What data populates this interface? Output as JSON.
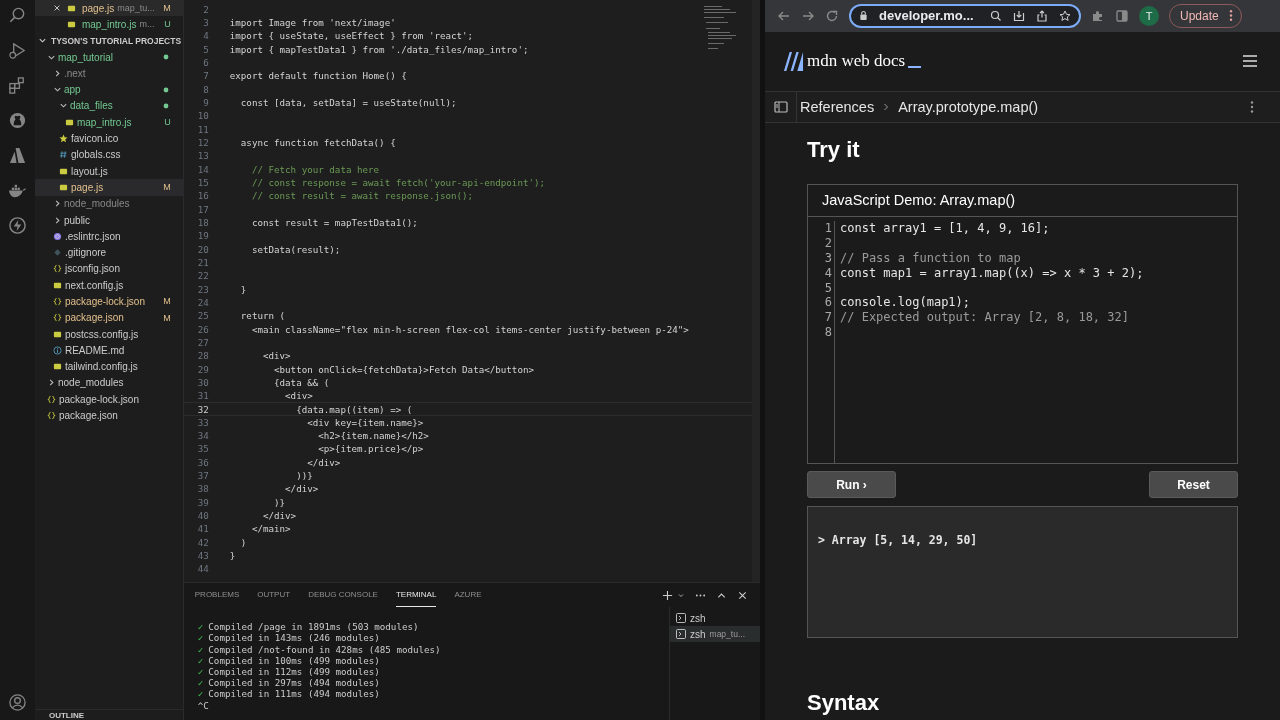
{
  "open_editors": [
    {
      "name": "page.js",
      "path": "map_tu...",
      "badge": "M",
      "modified": true,
      "untracked": false,
      "selected": true
    },
    {
      "name": "map_intro.js",
      "path": "m...",
      "badge": "U",
      "modified": false,
      "untracked": true,
      "selected": false
    }
  ],
  "sidebar": {
    "section": "TYSON'S TUTORIAL PROJECTS",
    "footer": "OUTLINE",
    "tree": [
      {
        "label": "map_tutorial",
        "kind": "folder",
        "expanded": true,
        "modified": false,
        "untracked": true,
        "ignored": false,
        "selected": false,
        "children": [
          {
            "label": ".next",
            "kind": "folder",
            "expanded": false,
            "modified": false,
            "untracked": false,
            "ignored": true,
            "selected": false
          },
          {
            "label": "app",
            "kind": "folder",
            "expanded": true,
            "modified": false,
            "untracked": true,
            "ignored": false,
            "selected": false,
            "children": [
              {
                "label": "data_files",
                "kind": "folder",
                "expanded": true,
                "modified": false,
                "untracked": true,
                "ignored": false,
                "selected": false,
                "children": [
                  {
                    "label": "map_intro.js",
                    "kind": "js",
                    "badge": "U",
                    "modified": false,
                    "untracked": true,
                    "ignored": false,
                    "selected": false
                  }
                ]
              },
              {
                "label": "favicon.ico",
                "kind": "ico",
                "modified": false,
                "untracked": false,
                "ignored": false,
                "selected": false
              },
              {
                "label": "globals.css",
                "kind": "css",
                "modified": false,
                "untracked": false,
                "ignored": false,
                "selected": false
              },
              {
                "label": "layout.js",
                "kind": "js",
                "modified": false,
                "untracked": false,
                "ignored": false,
                "selected": false
              },
              {
                "label": "page.js",
                "kind": "js",
                "badge": "M",
                "modified": true,
                "untracked": false,
                "ignored": false,
                "selected": true
              }
            ]
          },
          {
            "label": "node_modules",
            "kind": "folder",
            "expanded": false,
            "modified": false,
            "untracked": false,
            "ignored": true,
            "selected": false
          },
          {
            "label": "public",
            "kind": "folder",
            "expanded": false,
            "modified": false,
            "untracked": false,
            "ignored": false,
            "selected": false
          },
          {
            "label": ".eslintrc.json",
            "kind": "eslint",
            "modified": false,
            "untracked": false,
            "ignored": false,
            "selected": false
          },
          {
            "label": ".gitignore",
            "kind": "git",
            "modified": false,
            "untracked": false,
            "ignored": false,
            "selected": false
          },
          {
            "label": "jsconfig.json",
            "kind": "json",
            "modified": false,
            "untracked": false,
            "ignored": false,
            "selected": false
          },
          {
            "label": "next.config.js",
            "kind": "js",
            "modified": false,
            "untracked": false,
            "ignored": false,
            "selected": false
          },
          {
            "label": "package-lock.json",
            "kind": "json",
            "badge": "M",
            "modified": true,
            "untracked": false,
            "ignored": false,
            "selected": false
          },
          {
            "label": "package.json",
            "kind": "json",
            "badge": "M",
            "modified": true,
            "untracked": false,
            "ignored": false,
            "selected": false
          },
          {
            "label": "postcss.config.js",
            "kind": "js",
            "modified": false,
            "untracked": false,
            "ignored": false,
            "selected": false
          },
          {
            "label": "README.md",
            "kind": "md",
            "modified": false,
            "untracked": false,
            "ignored": false,
            "selected": false
          },
          {
            "label": "tailwind.config.js",
            "kind": "js",
            "modified": false,
            "untracked": false,
            "ignored": false,
            "selected": false
          }
        ]
      },
      {
        "label": "node_modules",
        "kind": "folder",
        "expanded": false,
        "modified": false,
        "untracked": false,
        "ignored": false,
        "selected": false
      },
      {
        "label": "package-lock.json",
        "kind": "json",
        "modified": false,
        "untracked": false,
        "ignored": false,
        "selected": false
      },
      {
        "label": "package.json",
        "kind": "json",
        "modified": false,
        "untracked": false,
        "ignored": false,
        "selected": false
      }
    ]
  },
  "editor": {
    "lines": [
      {
        "n": "2",
        "kind": "code",
        "current": false
      },
      {
        "n": "3",
        "kind": "code",
        "current": false,
        "text": "import Image from 'next/image'"
      },
      {
        "n": "4",
        "kind": "code",
        "current": false,
        "text": "import { useState, useEffect } from 'react';"
      },
      {
        "n": "5",
        "kind": "code",
        "current": false,
        "text": "import { mapTestData1 } from './data_files/map_intro';"
      },
      {
        "n": "6",
        "kind": "code",
        "current": false
      },
      {
        "n": "7",
        "kind": "code",
        "current": false,
        "text": "export default function Home() {"
      },
      {
        "n": "8",
        "kind": "code",
        "current": false
      },
      {
        "n": "9",
        "kind": "code",
        "current": false,
        "text": "  const [data, setData] = useState(null);"
      },
      {
        "n": "10",
        "kind": "code",
        "current": false
      },
      {
        "n": "11",
        "kind": "code",
        "current": false
      },
      {
        "n": "12",
        "kind": "code",
        "current": false,
        "text": "  async function fetchData() {"
      },
      {
        "n": "13",
        "kind": "code",
        "current": false
      },
      {
        "n": "14",
        "kind": "comment",
        "current": false,
        "text": "    // Fetch your data here"
      },
      {
        "n": "15",
        "kind": "comment",
        "current": false,
        "text": "    // const response = await fetch('your-api-endpoint');"
      },
      {
        "n": "16",
        "kind": "comment",
        "current": false,
        "text": "    // const result = await response.json();"
      },
      {
        "n": "17",
        "kind": "code",
        "current": false
      },
      {
        "n": "18",
        "kind": "code",
        "current": false,
        "text": "    const result = mapTestData1();"
      },
      {
        "n": "19",
        "kind": "code",
        "current": false
      },
      {
        "n": "20",
        "kind": "code",
        "current": false,
        "text": "    setData(result);"
      },
      {
        "n": "21",
        "kind": "code",
        "current": false
      },
      {
        "n": "22",
        "kind": "code",
        "current": false
      },
      {
        "n": "23",
        "kind": "code",
        "current": false,
        "text": "  }"
      },
      {
        "n": "24",
        "kind": "code",
        "current": false
      },
      {
        "n": "25",
        "kind": "code",
        "current": false,
        "text": "  return ("
      },
      {
        "n": "26",
        "kind": "code",
        "current": false,
        "text": "    <main className=\"flex min-h-screen flex-col items-center justify-between p-24\">"
      },
      {
        "n": "27",
        "kind": "code",
        "current": false
      },
      {
        "n": "28",
        "kind": "code",
        "current": false,
        "text": "      <div>"
      },
      {
        "n": "29",
        "kind": "code",
        "current": false,
        "text": "        <button onClick={fetchData}>Fetch Data</button>"
      },
      {
        "n": "30",
        "kind": "code",
        "current": false,
        "text": "        {data && ("
      },
      {
        "n": "31",
        "kind": "code",
        "current": false,
        "text": "          <div>"
      },
      {
        "n": "32",
        "kind": "code",
        "current": true,
        "text": "            {data.map((item) => ("
      },
      {
        "n": "33",
        "kind": "code",
        "current": false,
        "text": "              <div key={item.name}>"
      },
      {
        "n": "34",
        "kind": "code",
        "current": false,
        "text": "                <h2>{item.name}</h2>"
      },
      {
        "n": "35",
        "kind": "code",
        "current": false,
        "text": "                <p>{item.price}</p>"
      },
      {
        "n": "36",
        "kind": "code",
        "current": false,
        "text": "              </div>"
      },
      {
        "n": "37",
        "kind": "code",
        "current": false,
        "text": "            ))}"
      },
      {
        "n": "38",
        "kind": "code",
        "current": false,
        "text": "          </div>"
      },
      {
        "n": "39",
        "kind": "code",
        "current": false,
        "text": "        )}"
      },
      {
        "n": "40",
        "kind": "code",
        "current": false,
        "text": "      </div>"
      },
      {
        "n": "41",
        "kind": "code",
        "current": false,
        "text": "    </main>"
      },
      {
        "n": "42",
        "kind": "code",
        "current": false,
        "text": "  )"
      },
      {
        "n": "43",
        "kind": "code",
        "current": false,
        "text": "}"
      },
      {
        "n": "44",
        "kind": "code",
        "current": false
      }
    ]
  },
  "panel": {
    "tabs": [
      {
        "label": "PROBLEMS",
        "selected": false
      },
      {
        "label": "OUTPUT",
        "selected": false
      },
      {
        "label": "DEBUG CONSOLE",
        "selected": false
      },
      {
        "label": "TERMINAL",
        "selected": true
      },
      {
        "label": "AZURE",
        "selected": false
      }
    ],
    "terminal_lines": [
      {
        "mark": "✓",
        "text": "Compiled /page in 1891ms (503 modules)"
      },
      {
        "mark": "✓",
        "text": "Compiled in 143ms (246 modules)"
      },
      {
        "mark": "✓",
        "text": "Compiled /not-found in 428ms (485 modules)"
      },
      {
        "mark": "✓",
        "text": "Compiled in 100ms (499 modules)"
      },
      {
        "mark": "✓",
        "text": "Compiled in 112ms (499 modules)"
      },
      {
        "mark": "✓",
        "text": "Compiled in 297ms (494 modules)"
      },
      {
        "mark": "✓",
        "text": "Compiled in 111ms (494 modules)"
      },
      {
        "text": "^C"
      }
    ],
    "terminals": [
      {
        "name": "zsh",
        "selected": false
      },
      {
        "name": "zsh",
        "detail": "map_tu...",
        "selected": true
      }
    ]
  },
  "browser": {
    "url": "developer.mo...",
    "avatar": "T",
    "update_button": "Update",
    "site_logo": "mdn web docs",
    "breadcrumbs": [
      "References",
      "Array.prototype.map()"
    ],
    "heading": "Try it",
    "demo": {
      "title": "JavaScript Demo: Array.map()",
      "lines": [
        {
          "n": "1",
          "kind": "code",
          "text": "const array1 = [1, 4, 9, 16];"
        },
        {
          "n": "2",
          "kind": "code"
        },
        {
          "n": "3",
          "kind": "comment",
          "text": "// Pass a function to map"
        },
        {
          "n": "4",
          "kind": "code",
          "text": "const map1 = array1.map((x) => x * 3 + 2);"
        },
        {
          "n": "5",
          "kind": "code"
        },
        {
          "n": "6",
          "kind": "code",
          "text": "console.log(map1);"
        },
        {
          "n": "7",
          "kind": "comment",
          "text": "// Expected output: Array [2, 8, 18, 32]"
        },
        {
          "n": "8",
          "kind": "code"
        }
      ],
      "run_button": "Run ›",
      "reset_button": "Reset",
      "output": "> Array [5, 14, 29, 50]"
    },
    "next_heading": "Syntax"
  }
}
